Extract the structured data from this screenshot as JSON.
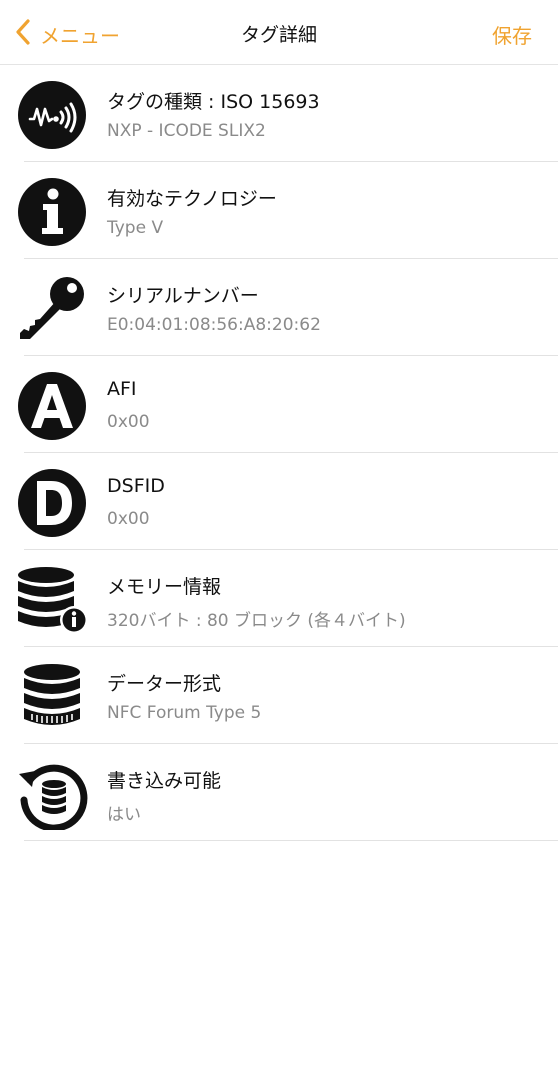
{
  "nav": {
    "back_label": "メニュー",
    "title": "タグ詳細",
    "save_label": "保存",
    "accent": "#f0a330"
  },
  "rows": [
    {
      "icon": "nfc-tag-icon",
      "title": "タグの種類 : ISO 15693",
      "subtitle": "NXP - ICODE SLIX2"
    },
    {
      "icon": "info-icon",
      "title": "有効なテクノロジー",
      "subtitle": "Type V"
    },
    {
      "icon": "key-icon",
      "title": "シリアルナンバー",
      "subtitle": "E0:04:01:08:56:A8:20:62"
    },
    {
      "icon": "letter-a-icon",
      "title": "AFI",
      "subtitle": "0x00"
    },
    {
      "icon": "letter-d-icon",
      "title": "DSFID",
      "subtitle": "0x00"
    },
    {
      "icon": "database-info-icon",
      "title": "メモリー情報",
      "subtitle": "320バイト : 80 ブロック (各４バイト)"
    },
    {
      "icon": "database-icon",
      "title": "データー形式",
      "subtitle": "NFC Forum Type 5"
    },
    {
      "icon": "database-rotate-icon",
      "title": "書き込み可能",
      "subtitle": "はい"
    }
  ]
}
